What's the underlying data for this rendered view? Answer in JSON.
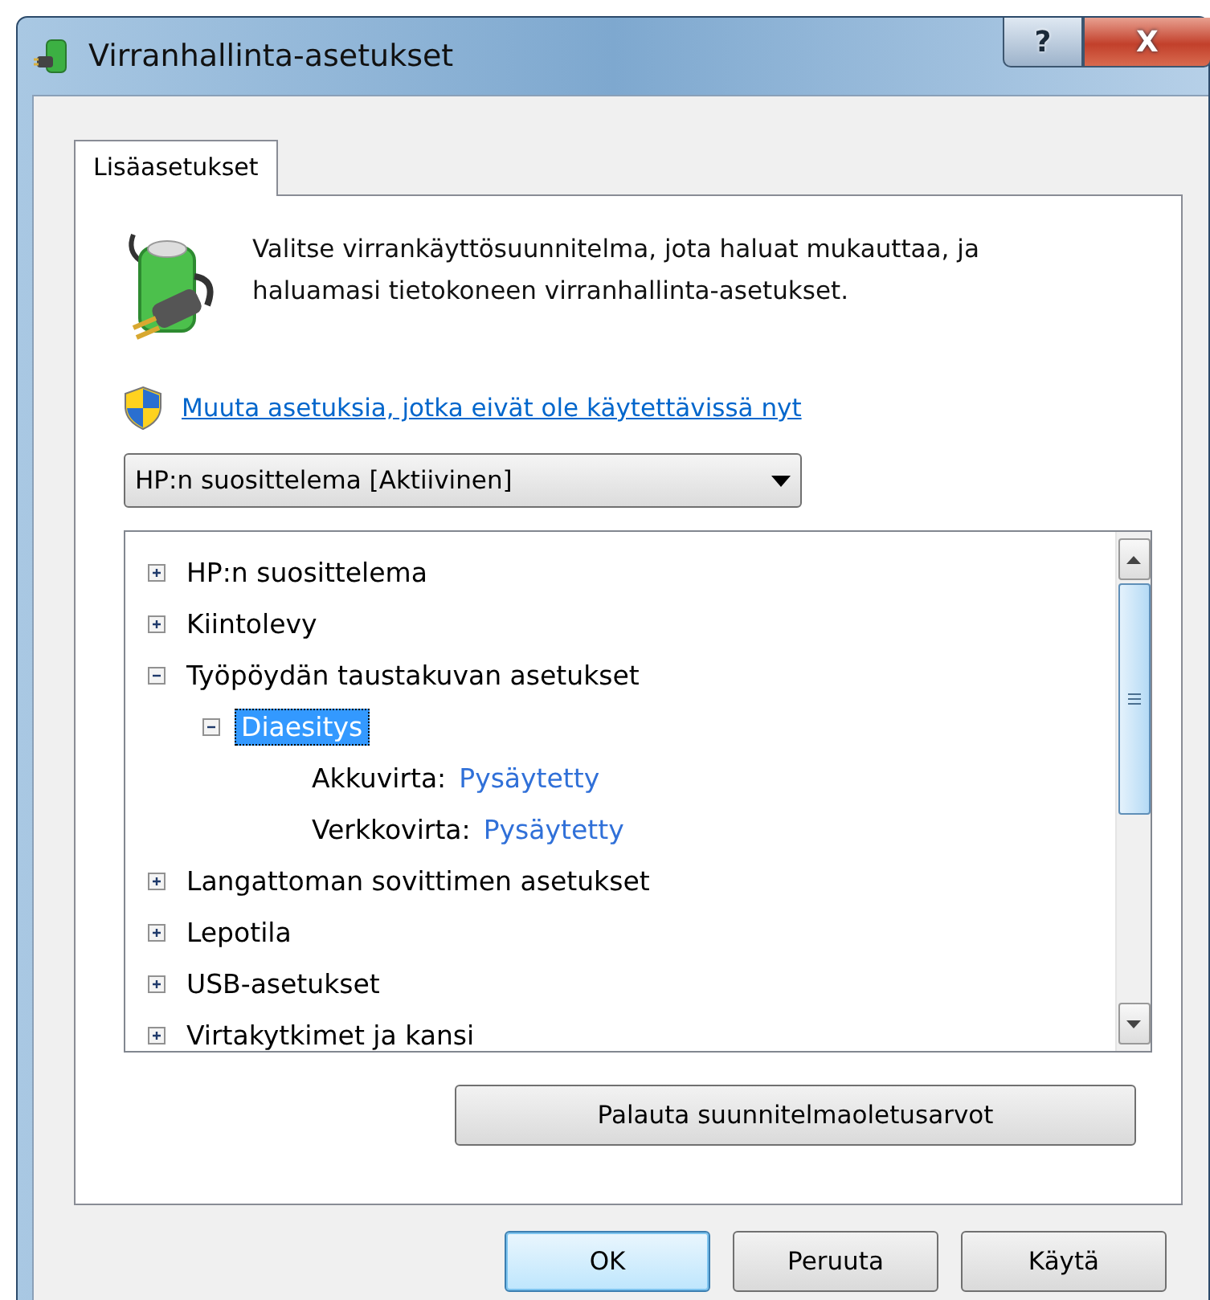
{
  "window": {
    "title": "Virranhallinta-asetukset",
    "help_button": "?",
    "close_button": "X"
  },
  "tabs": [
    {
      "label": "Lisäasetukset",
      "selected": true
    }
  ],
  "intro": "Valitse virrankäyttösuunnitelma, jota haluat mukauttaa, ja haluamasi tietokoneen virranhallinta-asetukset.",
  "admin_link": "Muuta asetuksia, jotka eivät ole käytettävissä nyt",
  "plan_dropdown": {
    "value": "HP:n suosittelema [Aktiivinen]"
  },
  "tree": [
    {
      "label": "HP:n suosittelema",
      "expanded": false,
      "selected": false
    },
    {
      "label": "Kiintolevy",
      "expanded": false,
      "selected": false
    },
    {
      "label": "Työpöydän taustakuvan asetukset",
      "expanded": true,
      "selected": false,
      "children": [
        {
          "label": "Diaesitys",
          "expanded": true,
          "selected": true,
          "settings": [
            {
              "label": "Akkuvirta:",
              "value": "Pysäytetty"
            },
            {
              "label": "Verkkovirta:",
              "value": "Pysäytetty"
            }
          ]
        }
      ]
    },
    {
      "label": "Langattoman sovittimen asetukset",
      "expanded": false,
      "selected": false
    },
    {
      "label": "Lepotila",
      "expanded": false,
      "selected": false
    },
    {
      "label": "USB-asetukset",
      "expanded": false,
      "selected": false
    },
    {
      "label": "Virtakytkimet ja kansi",
      "expanded": false,
      "selected": false
    }
  ],
  "restore_button": "Palauta suunnitelmaoletusarvot",
  "buttons": [
    {
      "label": "OK",
      "default": true
    },
    {
      "label": "Peruuta",
      "default": false
    },
    {
      "label": "Käytä",
      "default": false
    }
  ]
}
